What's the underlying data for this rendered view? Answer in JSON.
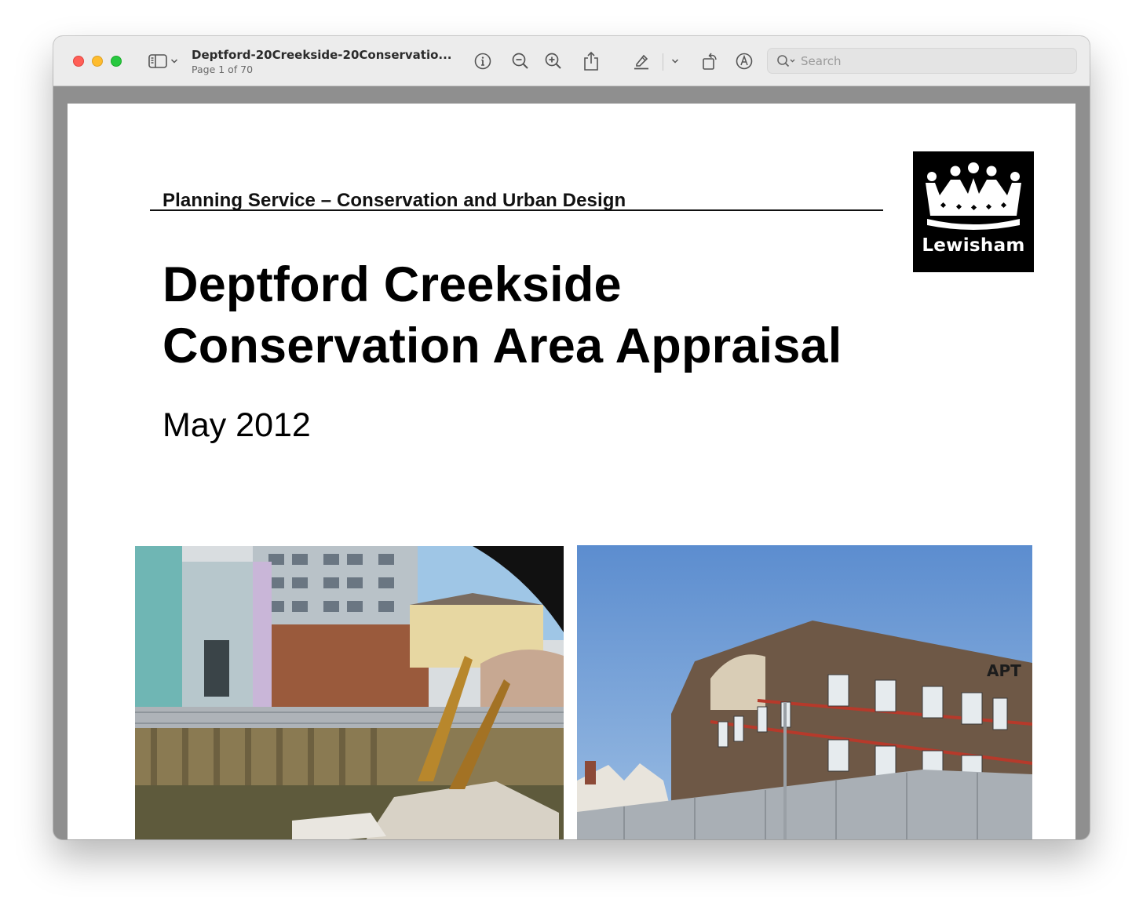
{
  "window": {
    "document_title": "Deptford-20Creekside-20Conservatio...",
    "page_indicator": "Page 1 of 70"
  },
  "toolbar": {
    "icons": [
      "sidebar-icon",
      "chevron-down-icon",
      "info-icon",
      "zoom-out-icon",
      "zoom-in-icon",
      "share-icon",
      "highlight-pen-icon",
      "chevron-down-icon",
      "rotate-icon",
      "markup-icon",
      "search-icon"
    ],
    "search_placeholder": "Search"
  },
  "document": {
    "header": "Planning Service – Conservation and Urban Design",
    "logo_text": "Lewisham",
    "title_line1": "Deptford Creekside",
    "title_line2": "Conservation Area Appraisal",
    "date": "May 2012"
  },
  "colors": {
    "close": "#ff5f57",
    "minimize": "#febc2e",
    "zoom": "#28c840",
    "toolbar_bg": "#ececec",
    "canvas_bg": "#8f8f8f"
  }
}
